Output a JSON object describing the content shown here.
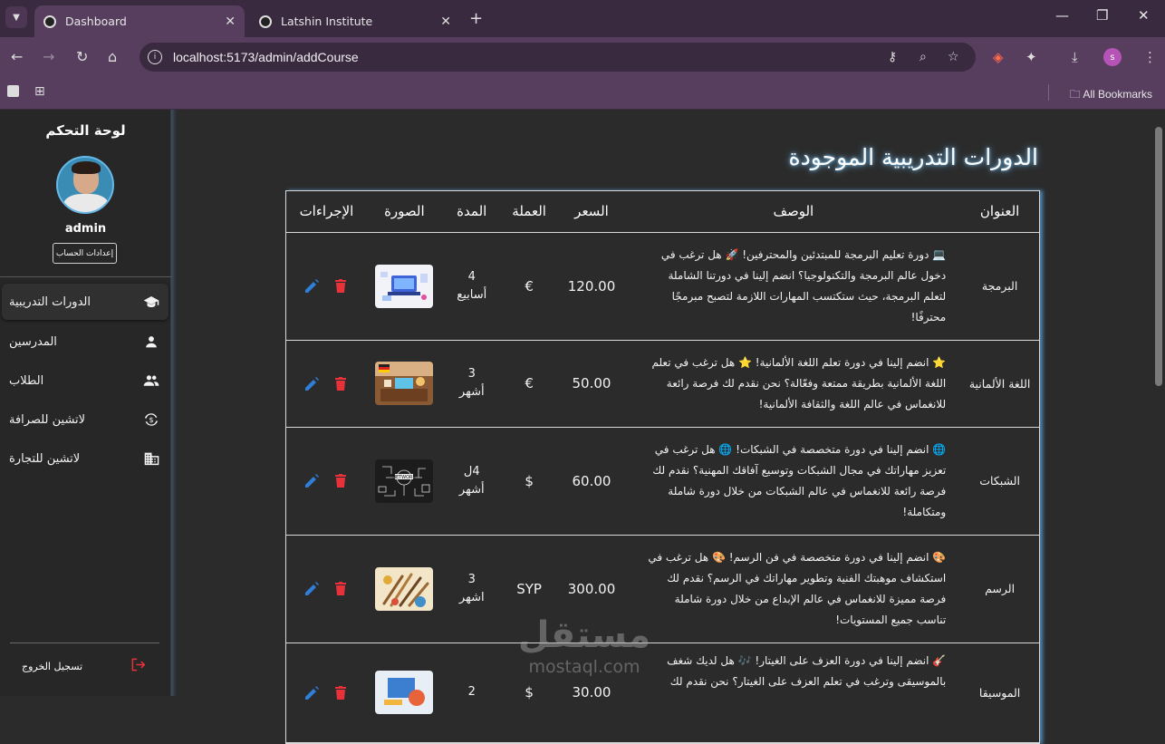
{
  "browser": {
    "tabs": [
      {
        "title": "Dashboard",
        "active": true
      },
      {
        "title": "Latshin Institute",
        "active": false
      }
    ],
    "url": "localhost:5173/admin/addCourse",
    "bookmarks_label": "All Bookmarks",
    "profile_initial": "s"
  },
  "sidebar": {
    "title": "لوحة التحكم",
    "username": "admin",
    "settings_button": "إعدادات الحساب",
    "items": [
      {
        "label": "الدورات التدريبية",
        "icon": "graduation-cap-icon",
        "active": true
      },
      {
        "label": "المدرسين",
        "icon": "person-icon",
        "active": false
      },
      {
        "label": "الطلاب",
        "icon": "people-icon",
        "active": false
      },
      {
        "label": "لاتشين للصرافة",
        "icon": "currency-exchange-icon",
        "active": false
      },
      {
        "label": "لاتشين للتجارة",
        "icon": "building-icon",
        "active": false
      }
    ],
    "logout": "تسجيل الخروج"
  },
  "main": {
    "heading": "الدورات التدريبية الموجودة",
    "table": {
      "headers": {
        "title": "العنوان",
        "description": "الوصف",
        "price": "السعر",
        "currency": "العملة",
        "duration": "المدة",
        "image": "الصورة",
        "actions": "الإجراءات"
      },
      "rows": [
        {
          "title": "البرمجة",
          "description": "💻 دورة تعليم البرمجة للمبتدئين والمحترفين! 🚀 هل ترغب في دخول عالم البرمجة والتكنولوجيا؟ انضم إلينا في دورتنا الشاملة لتعلم البرمجة، حيث ستكتسب المهارات اللازمة لتصبح مبرمجًا محترفًا!",
          "price": "120.00",
          "currency": "€",
          "duration_num": "4",
          "duration_unit": "أسابيع"
        },
        {
          "title": "اللغة الألمانية",
          "description": "⭐ انضم إلينا في دورة تعلم اللغة الألمانية! ⭐ هل ترغب في تعلم اللغة الألمانية بطريقة ممتعة وفعّالة؟ نحن نقدم لك فرصة رائعة للانغماس في عالم اللغة والثقافة الألمانية!",
          "price": "50.00",
          "currency": "€",
          "duration_num": "3",
          "duration_unit": "أشهر"
        },
        {
          "title": "الشبكات",
          "description": "🌐 انضم إلينا في دورة متخصصة في الشبكات! 🌐 هل ترغب في تعزيز مهاراتك في مجال الشبكات وتوسيع آفاقك المهنية؟ نقدم لك فرصة رائعة للانغماس في عالم الشبكات من خلال دورة شاملة ومتكاملة!",
          "price": "60.00",
          "currency": "$",
          "duration_num": "4ل",
          "duration_unit": "أشهر"
        },
        {
          "title": "الرسم",
          "description": "🎨 انضم إلينا في دورة متخصصة في فن الرسم! 🎨 هل ترغب في استكشاف موهبتك الفنية وتطوير مهاراتك في الرسم؟ نقدم لك فرصة مميزة للانغماس في عالم الإبداع من خلال دورة شاملة تناسب جميع المستويات!",
          "price": "300.00",
          "currency": "SYP",
          "duration_num": "3",
          "duration_unit": "اشهر"
        },
        {
          "title": "الموسيقا",
          "description": "🎸 انضم إلينا في دورة العزف على الغيتار! 🎶 هل لديك شغف بالموسيقى وترغب في تعلم العزف على الغيتار؟ نحن نقدم لك",
          "price": "30.00",
          "currency": "$",
          "duration_num": "2",
          "duration_unit": ""
        }
      ]
    }
  },
  "watermark": {
    "line1": "مستقل",
    "line2": "mostaql.com"
  },
  "colors": {
    "accent_glow": "#6fb1de",
    "edit": "#2f7fd8",
    "delete": "#e8323a",
    "logout": "#e8323a"
  }
}
